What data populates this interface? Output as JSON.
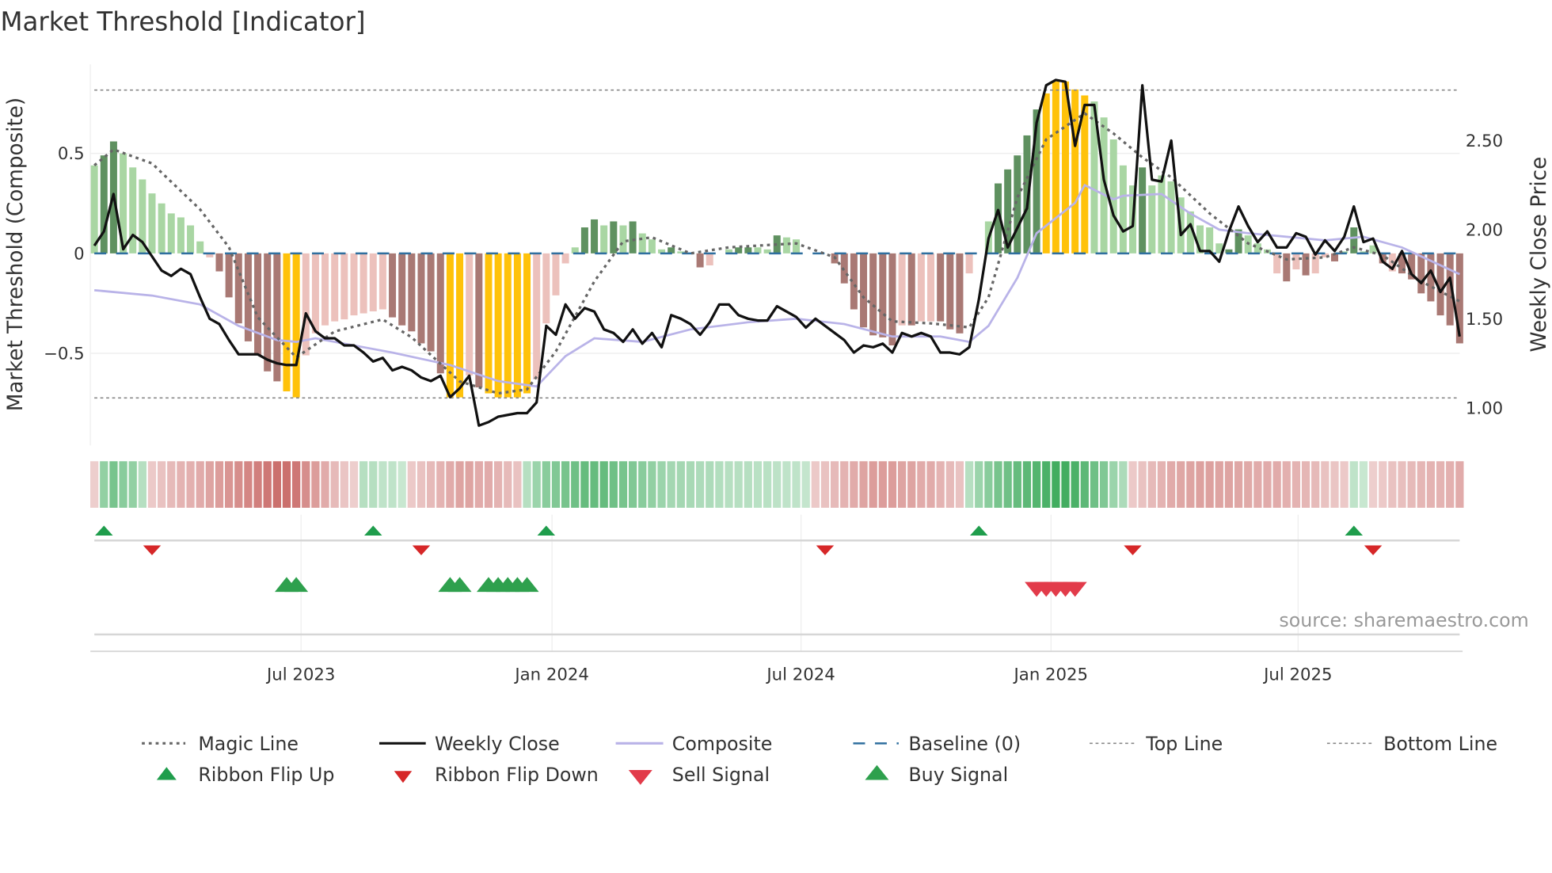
{
  "title": "Market Threshold [Indicator]",
  "source_note": "source: sharemaestro.com",
  "colors": {
    "LG": "#a9d6a3",
    "DG": "#5f9160",
    "LR": "#ecc1bc",
    "DR": "#a97974",
    "Y": "#ffc20a",
    "magic": "#666666",
    "close": "#111111",
    "composite": "#b9b3e8",
    "baseline": "#2f6f9f",
    "threshold": "#888888",
    "ribbon_green": "#2ea44f",
    "ribbon_red": "#c0504d",
    "flip_up": "#1f9d4c",
    "flip_down": "#d62728",
    "sell": "#e23b4a",
    "buy": "#2ea04d",
    "source": "#999999"
  },
  "chart_data": {
    "type": "bar",
    "title": "Market Threshold [Indicator]",
    "ylabel": "Market Threshold (Composite)",
    "y2label": "Weekly Close Price",
    "ylim": [
      -0.92,
      0.95
    ],
    "y2lim": [
      0.8,
      2.88
    ],
    "x_unit": "week index",
    "xlim": [
      0,
      142
    ],
    "y_ticks": [
      {
        "v": 0.5,
        "label": "0.5"
      },
      {
        "v": 0,
        "label": "0"
      },
      {
        "v": -0.5,
        "label": "−0.5"
      }
    ],
    "y2_ticks": [
      {
        "v": 2.5,
        "label": "2.50"
      },
      {
        "v": 2.0,
        "label": "2.00"
      },
      {
        "v": 1.5,
        "label": "1.50"
      },
      {
        "v": 1.0,
        "label": "1.00"
      }
    ],
    "x_ticks": [
      {
        "x": 21.5,
        "label": "Jul 2023"
      },
      {
        "x": 47.6,
        "label": "Jan 2024"
      },
      {
        "x": 73.5,
        "label": "Jul 2024"
      },
      {
        "x": 99.5,
        "label": "Jan 2025"
      },
      {
        "x": 125.2,
        "label": "Jul 2025"
      }
    ],
    "top_line": 0.817,
    "bottom_line": -0.723,
    "baseline": 0,
    "composite_bars": [
      [
        0.44,
        "LG"
      ],
      [
        0.49,
        "DG"
      ],
      [
        0.56,
        "DG"
      ],
      [
        0.5,
        "LG"
      ],
      [
        0.43,
        "LG"
      ],
      [
        0.37,
        "LG"
      ],
      [
        0.3,
        "LG"
      ],
      [
        0.25,
        "LG"
      ],
      [
        0.2,
        "LG"
      ],
      [
        0.18,
        "LG"
      ],
      [
        0.14,
        "LG"
      ],
      [
        0.06,
        "LG"
      ],
      [
        -0.02,
        "LR"
      ],
      [
        -0.09,
        "DR"
      ],
      [
        -0.22,
        "DR"
      ],
      [
        -0.35,
        "DR"
      ],
      [
        -0.44,
        "DR"
      ],
      [
        -0.51,
        "DR"
      ],
      [
        -0.59,
        "DR"
      ],
      [
        -0.64,
        "DR"
      ],
      [
        -0.69,
        "Y"
      ],
      [
        -0.72,
        "Y"
      ],
      [
        -0.51,
        "LR"
      ],
      [
        -0.4,
        "LR"
      ],
      [
        -0.36,
        "LR"
      ],
      [
        -0.34,
        "LR"
      ],
      [
        -0.33,
        "LR"
      ],
      [
        -0.31,
        "LR"
      ],
      [
        -0.3,
        "LR"
      ],
      [
        -0.29,
        "LR"
      ],
      [
        -0.28,
        "LR"
      ],
      [
        -0.32,
        "DR"
      ],
      [
        -0.36,
        "DR"
      ],
      [
        -0.39,
        "DR"
      ],
      [
        -0.45,
        "DR"
      ],
      [
        -0.49,
        "DR"
      ],
      [
        -0.6,
        "DR"
      ],
      [
        -0.72,
        "Y"
      ],
      [
        -0.72,
        "Y"
      ],
      [
        -0.61,
        "LR"
      ],
      [
        -0.67,
        "DR"
      ],
      [
        -0.7,
        "Y"
      ],
      [
        -0.72,
        "Y"
      ],
      [
        -0.72,
        "Y"
      ],
      [
        -0.72,
        "Y"
      ],
      [
        -0.7,
        "Y"
      ],
      [
        -0.63,
        "LR"
      ],
      [
        -0.35,
        "LR"
      ],
      [
        -0.21,
        "LR"
      ],
      [
        -0.05,
        "LR"
      ],
      [
        0.03,
        "LG"
      ],
      [
        0.13,
        "DG"
      ],
      [
        0.17,
        "DG"
      ],
      [
        0.14,
        "LG"
      ],
      [
        0.16,
        "DG"
      ],
      [
        0.14,
        "LG"
      ],
      [
        0.16,
        "DG"
      ],
      [
        0.1,
        "LG"
      ],
      [
        0.07,
        "LG"
      ],
      [
        0.02,
        "LG"
      ],
      [
        0.03,
        "DG"
      ],
      [
        0.01,
        "LG"
      ],
      [
        0,
        "LG"
      ],
      [
        -0.07,
        "DR"
      ],
      [
        -0.06,
        "LR"
      ],
      [
        0,
        "LG"
      ],
      [
        0.02,
        "LG"
      ],
      [
        0.03,
        "DG"
      ],
      [
        0.03,
        "DG"
      ],
      [
        0.03,
        "LG"
      ],
      [
        0.02,
        "LG"
      ],
      [
        0.09,
        "DG"
      ],
      [
        0.08,
        "LG"
      ],
      [
        0.07,
        "LG"
      ],
      [
        0,
        "LG"
      ],
      [
        0,
        "LG"
      ],
      [
        0,
        "LG"
      ],
      [
        -0.05,
        "DR"
      ],
      [
        -0.15,
        "DR"
      ],
      [
        -0.28,
        "DR"
      ],
      [
        -0.37,
        "DR"
      ],
      [
        -0.41,
        "DR"
      ],
      [
        -0.42,
        "DR"
      ],
      [
        -0.46,
        "DR"
      ],
      [
        -0.36,
        "LR"
      ],
      [
        -0.36,
        "DR"
      ],
      [
        -0.34,
        "LR"
      ],
      [
        -0.34,
        "LR"
      ],
      [
        -0.34,
        "DR"
      ],
      [
        -0.38,
        "DR"
      ],
      [
        -0.4,
        "DR"
      ],
      [
        -0.1,
        "LR"
      ],
      [
        0,
        "LG"
      ],
      [
        0.16,
        "LG"
      ],
      [
        0.35,
        "DG"
      ],
      [
        0.42,
        "DG"
      ],
      [
        0.49,
        "DG"
      ],
      [
        0.59,
        "DG"
      ],
      [
        0.72,
        "DG"
      ],
      [
        0.8,
        "Y"
      ],
      [
        0.86,
        "Y"
      ],
      [
        0.86,
        "Y"
      ],
      [
        0.82,
        "Y"
      ],
      [
        0.79,
        "Y"
      ],
      [
        0.76,
        "LG"
      ],
      [
        0.68,
        "LG"
      ],
      [
        0.57,
        "LG"
      ],
      [
        0.44,
        "LG"
      ],
      [
        0.34,
        "LG"
      ],
      [
        0.43,
        "DG"
      ],
      [
        0.34,
        "LG"
      ],
      [
        0.39,
        "LG"
      ],
      [
        0.36,
        "LG"
      ],
      [
        0.28,
        "LG"
      ],
      [
        0.21,
        "LG"
      ],
      [
        0.14,
        "LG"
      ],
      [
        0.13,
        "LG"
      ],
      [
        0.05,
        "LG"
      ],
      [
        0.02,
        "DG"
      ],
      [
        0.12,
        "DG"
      ],
      [
        0.09,
        "LG"
      ],
      [
        0.05,
        "LG"
      ],
      [
        0.02,
        "LG"
      ],
      [
        -0.1,
        "LR"
      ],
      [
        -0.14,
        "DR"
      ],
      [
        -0.08,
        "LR"
      ],
      [
        -0.11,
        "DR"
      ],
      [
        -0.1,
        "LR"
      ],
      [
        -0.02,
        "LR"
      ],
      [
        -0.04,
        "DR"
      ],
      [
        0.01,
        "LG"
      ],
      [
        0.13,
        "DG"
      ],
      [
        0.01,
        "LG"
      ],
      [
        0.04,
        "LG"
      ],
      [
        -0.05,
        "DR"
      ],
      [
        -0.09,
        "LR"
      ],
      [
        -0.1,
        "DR"
      ],
      [
        -0.13,
        "DR"
      ],
      [
        -0.2,
        "DR"
      ],
      [
        -0.24,
        "DR"
      ],
      [
        -0.31,
        "DR"
      ],
      [
        -0.36,
        "DR"
      ],
      [
        -0.45,
        "DR"
      ]
    ],
    "weekly_close": [
      1.91,
      1.99,
      2.2,
      1.89,
      1.97,
      1.93,
      1.85,
      1.77,
      1.74,
      1.78,
      1.75,
      1.62,
      1.5,
      1.47,
      1.38,
      1.3,
      1.3,
      1.3,
      1.27,
      1.25,
      1.24,
      1.24,
      1.53,
      1.43,
      1.39,
      1.39,
      1.35,
      1.35,
      1.31,
      1.26,
      1.28,
      1.21,
      1.23,
      1.21,
      1.17,
      1.15,
      1.18,
      1.06,
      1.11,
      1.18,
      0.9,
      0.92,
      0.95,
      0.96,
      0.97,
      0.97,
      1.03,
      1.46,
      1.41,
      1.58,
      1.5,
      1.56,
      1.54,
      1.44,
      1.42,
      1.37,
      1.44,
      1.36,
      1.42,
      1.34,
      1.52,
      1.5,
      1.47,
      1.41,
      1.48,
      1.58,
      1.58,
      1.52,
      1.5,
      1.49,
      1.49,
      1.57,
      1.54,
      1.51,
      1.45,
      1.5,
      1.46,
      1.42,
      1.38,
      1.31,
      1.35,
      1.34,
      1.36,
      1.31,
      1.42,
      1.4,
      1.42,
      1.4,
      1.31,
      1.31,
      1.3,
      1.34,
      1.61,
      1.95,
      2.11,
      1.9,
      2.01,
      2.12,
      2.6,
      2.81,
      2.84,
      2.83,
      2.47,
      2.7,
      2.7,
      2.28,
      2.08,
      1.99,
      2.02,
      2.81,
      2.28,
      2.27,
      2.5,
      1.97,
      2.03,
      1.88,
      1.88,
      1.82,
      1.99,
      2.13,
      2.02,
      1.93,
      1.99,
      1.9,
      1.9,
      1.98,
      1.96,
      1.86,
      1.94,
      1.88,
      1.96,
      2.13,
      1.93,
      1.95,
      1.82,
      1.78,
      1.88,
      1.75,
      1.7,
      1.77,
      1.65,
      1.73,
      1.4
    ],
    "magic_line": [
      [
        0,
        0.44
      ],
      [
        2,
        0.52
      ],
      [
        6,
        0.45
      ],
      [
        11,
        0.22
      ],
      [
        14,
        0.03
      ],
      [
        17,
        -0.32
      ],
      [
        21,
        -0.52
      ],
      [
        25,
        -0.39
      ],
      [
        30,
        -0.33
      ],
      [
        33,
        -0.42
      ],
      [
        38,
        -0.64
      ],
      [
        42,
        -0.7
      ],
      [
        45,
        -0.68
      ],
      [
        48,
        -0.49
      ],
      [
        52,
        -0.14
      ],
      [
        55,
        0.06
      ],
      [
        58,
        0.08
      ],
      [
        62,
        0
      ],
      [
        66,
        0.03
      ],
      [
        73,
        0.05
      ],
      [
        77,
        -0.02
      ],
      [
        80,
        -0.22
      ],
      [
        83,
        -0.34
      ],
      [
        87,
        -0.35
      ],
      [
        91,
        -0.37
      ],
      [
        93,
        -0.22
      ],
      [
        96,
        0.28
      ],
      [
        99,
        0.57
      ],
      [
        103,
        0.7
      ],
      [
        106,
        0.6
      ],
      [
        109,
        0.48
      ],
      [
        112,
        0.38
      ],
      [
        116,
        0.2
      ],
      [
        120,
        0.05
      ],
      [
        124,
        -0.03
      ],
      [
        128,
        -0.02
      ],
      [
        131,
        0.03
      ],
      [
        134,
        -0.01
      ],
      [
        138,
        -0.14
      ],
      [
        142,
        -0.24
      ]
    ],
    "composite_line": [
      [
        0,
        1.66
      ],
      [
        6,
        1.63
      ],
      [
        11,
        1.58
      ],
      [
        15,
        1.46
      ],
      [
        19,
        1.38
      ],
      [
        21,
        1.37
      ],
      [
        23,
        1.39
      ],
      [
        26,
        1.36
      ],
      [
        31,
        1.31
      ],
      [
        37,
        1.24
      ],
      [
        42,
        1.15
      ],
      [
        46,
        1.12
      ],
      [
        49,
        1.29
      ],
      [
        52,
        1.39
      ],
      [
        57,
        1.37
      ],
      [
        62,
        1.44
      ],
      [
        68,
        1.48
      ],
      [
        73,
        1.5
      ],
      [
        78,
        1.47
      ],
      [
        83,
        1.4
      ],
      [
        88,
        1.4
      ],
      [
        91,
        1.37
      ],
      [
        93,
        1.46
      ],
      [
        96,
        1.73
      ],
      [
        98,
        1.98
      ],
      [
        102,
        2.15
      ],
      [
        103,
        2.25
      ],
      [
        106,
        2.17
      ],
      [
        107,
        2.19
      ],
      [
        111,
        2.2
      ],
      [
        114,
        2.09
      ],
      [
        117,
        2.0
      ],
      [
        120,
        1.98
      ],
      [
        124,
        1.96
      ],
      [
        128,
        1.94
      ],
      [
        132,
        1.96
      ],
      [
        136,
        1.9
      ],
      [
        142,
        1.75
      ]
    ],
    "ribbon": [
      -0.12,
      0.4,
      0.55,
      0.45,
      0.4,
      0.2,
      -0.15,
      -0.2,
      -0.25,
      -0.3,
      -0.32,
      -0.35,
      -0.4,
      -0.45,
      -0.5,
      -0.55,
      -0.6,
      -0.65,
      -0.7,
      -0.75,
      -0.75,
      -0.7,
      -0.55,
      -0.45,
      -0.35,
      -0.25,
      -0.18,
      -0.12,
      0.2,
      0.2,
      0.15,
      0.15,
      0.1,
      -0.15,
      -0.2,
      -0.25,
      -0.3,
      -0.35,
      -0.4,
      -0.4,
      -0.35,
      -0.35,
      -0.3,
      -0.25,
      -0.2,
      0.2,
      0.35,
      0.45,
      0.5,
      0.55,
      0.6,
      0.65,
      0.65,
      0.65,
      0.6,
      0.55,
      0.5,
      0.45,
      0.4,
      0.35,
      0.3,
      0.3,
      0.28,
      0.25,
      0.25,
      0.22,
      0.2,
      0.2,
      0.2,
      0.18,
      0.18,
      0.16,
      0.15,
      0.15,
      0.12,
      -0.15,
      -0.2,
      -0.25,
      -0.3,
      -0.35,
      -0.4,
      -0.45,
      -0.45,
      -0.45,
      -0.4,
      -0.4,
      -0.35,
      -0.35,
      -0.3,
      -0.25,
      -0.2,
      0.2,
      0.35,
      0.45,
      0.55,
      0.6,
      0.65,
      0.7,
      0.75,
      0.8,
      0.85,
      0.85,
      0.8,
      0.7,
      0.6,
      0.5,
      0.35,
      0.25,
      -0.15,
      -0.2,
      -0.25,
      -0.3,
      -0.35,
      -0.38,
      -0.4,
      -0.42,
      -0.42,
      -0.4,
      -0.4,
      -0.38,
      -0.36,
      -0.35,
      -0.35,
      -0.35,
      -0.32,
      -0.3,
      -0.28,
      -0.25,
      -0.2,
      -0.18,
      -0.15,
      0.15,
      0.1,
      -0.12,
      -0.15,
      -0.2,
      -0.22,
      -0.25,
      -0.28,
      -0.3,
      -0.3,
      -0.32,
      -0.35
    ],
    "ribbon_flip_up": [
      1,
      29,
      47,
      92,
      131
    ],
    "ribbon_flip_down": [
      6,
      34,
      76,
      108,
      133
    ],
    "buy_signals": [
      20,
      21,
      37,
      38,
      41,
      42,
      43,
      44,
      45
    ],
    "sell_signals": [
      98,
      99,
      100,
      101,
      102
    ],
    "legend": {
      "placement": "bottom",
      "items": [
        {
          "key": "magic",
          "label": "Magic Line"
        },
        {
          "key": "close",
          "label": "Weekly Close"
        },
        {
          "key": "composite",
          "label": "Composite"
        },
        {
          "key": "baseline",
          "label": "Baseline (0)"
        },
        {
          "key": "top",
          "label": "Top Line"
        },
        {
          "key": "bottom",
          "label": "Bottom Line"
        },
        {
          "key": "flip_up",
          "label": "Ribbon Flip Up"
        },
        {
          "key": "flip_down",
          "label": "Ribbon Flip Down"
        },
        {
          "key": "sell",
          "label": "Sell Signal"
        },
        {
          "key": "buy",
          "label": "Buy Signal"
        }
      ]
    }
  }
}
